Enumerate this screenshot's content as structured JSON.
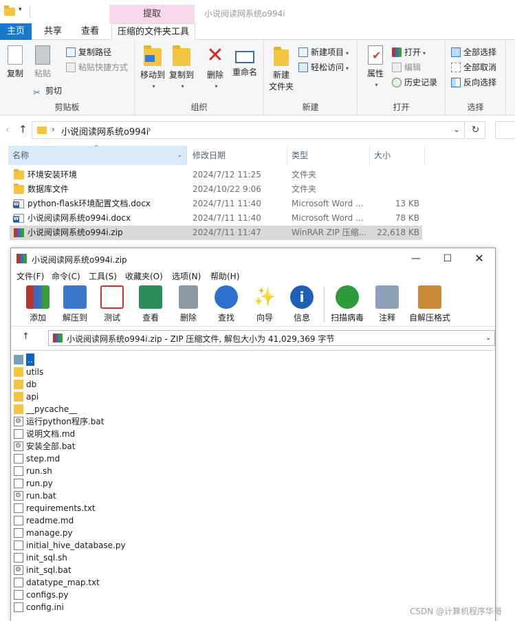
{
  "explorer": {
    "quick_access_caret": "▾",
    "context_tab": "提取",
    "window_title": "小说阅读网系统o994i",
    "tabs": [
      "主页",
      "共享",
      "查看",
      "压缩的文件夹工具"
    ],
    "ribbon": {
      "clipboard": {
        "label": "剪贴板",
        "copy": "复制",
        "paste": "粘贴",
        "copy_path": "复制路径",
        "paste_shortcut": "粘贴快捷方式",
        "cut": "剪切"
      },
      "organize": {
        "label": "组织",
        "move_to": "移动到",
        "copy_to": "复制到",
        "delete": "删除",
        "rename": "重命名"
      },
      "new": {
        "label": "新建",
        "new_folder_l1": "新建",
        "new_folder_l2": "文件夹",
        "new_item": "新建项目",
        "easy_access": "轻松访问"
      },
      "open": {
        "label": "打开",
        "properties": "属性",
        "open": "打开",
        "edit": "编辑",
        "history": "历史记录"
      },
      "select": {
        "label": "选择",
        "select_all": "全部选择",
        "select_none": "全部取消",
        "invert": "反向选择"
      }
    },
    "address": {
      "path": "小说阅读网系统o994i"
    },
    "columns": {
      "name": "名称",
      "date": "修改日期",
      "type": "类型",
      "size": "大小"
    },
    "files": [
      {
        "icon": "folder-icon",
        "name": "环境安装环境",
        "date": "2024/7/12 11:25",
        "type": "文件夹",
        "size": ""
      },
      {
        "icon": "folder-icon",
        "name": "数据库文件",
        "date": "2024/10/22 9:06",
        "type": "文件夹",
        "size": ""
      },
      {
        "icon": "word-doc-icon",
        "name": "python-flask环境配置文档.docx",
        "date": "2024/7/11 11:40",
        "type": "Microsoft Word ...",
        "size": "13 KB"
      },
      {
        "icon": "word-doc-icon",
        "name": "小说阅读网系统o994i.docx",
        "date": "2024/7/11 11:40",
        "type": "Microsoft Word ...",
        "size": "78 KB"
      },
      {
        "icon": "winrar-archive-icon",
        "name": "小说阅读网系统o994i.zip",
        "date": "2024/7/11 11:47",
        "type": "WinRAR ZIP 压缩...",
        "size": "22,618 KB"
      }
    ]
  },
  "winrar": {
    "title": "小说阅读网系统o994i.zip",
    "controls": {
      "minimize": "—",
      "maximize": "☐",
      "close": "✕"
    },
    "menu": [
      "文件(F)",
      "命令(C)",
      "工具(S)",
      "收藏夹(O)",
      "选项(N)",
      "帮助(H)"
    ],
    "tools": [
      {
        "label": "添加",
        "icon": "add-archive-icon",
        "color": "#b5342b"
      },
      {
        "label": "解压到",
        "icon": "extract-folder-icon",
        "color": "#3a78c9"
      },
      {
        "label": "测试",
        "icon": "test-clipboard-icon",
        "color": "#c0392b"
      },
      {
        "label": "查看",
        "icon": "view-book-icon",
        "color": "#2e8b57"
      },
      {
        "label": "删除",
        "icon": "trash-icon",
        "color": "#8c98a4"
      },
      {
        "label": "查找",
        "icon": "magnifier-icon",
        "color": "#2f6fcf"
      },
      {
        "label": "向导",
        "icon": "wizard-wand-icon",
        "color": "#9aa7b0"
      },
      {
        "label": "信息",
        "icon": "info-icon",
        "color": "#1f5fb8"
      },
      {
        "label": "扫描病毒",
        "icon": "virus-scan-icon",
        "color": "#2e9b3a"
      },
      {
        "label": "注释",
        "icon": "comment-icon",
        "color": "#8da2b8"
      },
      {
        "label": "自解压格式",
        "icon": "sfx-box-icon",
        "color": "#c98b3a"
      }
    ],
    "path_text": "小说阅读网系统o994i.zip - ZIP 压缩文件, 解包大小为 41,029,369 字节",
    "entries": [
      {
        "name": "..",
        "kind": "up"
      },
      {
        "name": "utils",
        "kind": "folder"
      },
      {
        "name": "db",
        "kind": "folder"
      },
      {
        "name": "api",
        "kind": "folder"
      },
      {
        "name": "__pycache__",
        "kind": "folder"
      },
      {
        "name": "运行python程序.bat",
        "kind": "bat"
      },
      {
        "name": "说明文档.md",
        "kind": "file"
      },
      {
        "name": "安装全部.bat",
        "kind": "bat"
      },
      {
        "name": "step.md",
        "kind": "file"
      },
      {
        "name": "run.sh",
        "kind": "file"
      },
      {
        "name": "run.py",
        "kind": "file"
      },
      {
        "name": "run.bat",
        "kind": "bat"
      },
      {
        "name": "requirements.txt",
        "kind": "file"
      },
      {
        "name": "readme.md",
        "kind": "file"
      },
      {
        "name": "manage.py",
        "kind": "file"
      },
      {
        "name": "initial_hive_database.py",
        "kind": "file"
      },
      {
        "name": "init_sql.sh",
        "kind": "file"
      },
      {
        "name": "init_sql.bat",
        "kind": "bat"
      },
      {
        "name": "datatype_map.txt",
        "kind": "file"
      },
      {
        "name": "configs.py",
        "kind": "file"
      },
      {
        "name": "config.ini",
        "kind": "file"
      }
    ]
  },
  "watermark": "CSDN @计算机程序华哥"
}
